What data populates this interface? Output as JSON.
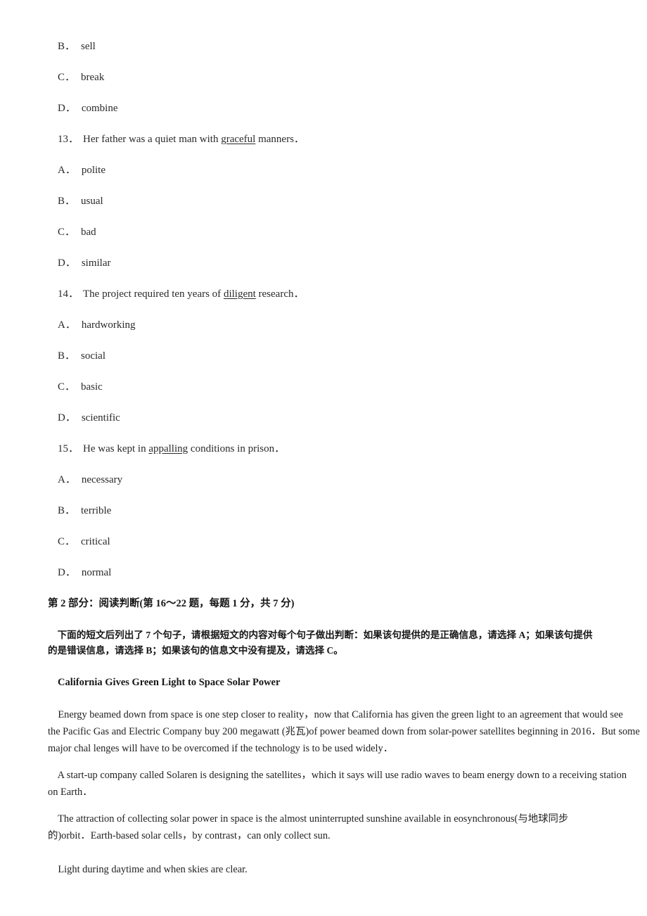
{
  "page": {
    "background": "#ffffff",
    "text_color": "#222222"
  },
  "vocabulary": {
    "carryover_options": [
      {
        "letter": "B．",
        "text": "sell"
      },
      {
        "letter": "C．",
        "text": "break"
      },
      {
        "letter": "D．",
        "text": "combine"
      }
    ],
    "questions": [
      {
        "number": "13．",
        "stem_before": "Her father was a quiet man with ",
        "stem_underlined": "graceful",
        "stem_after": " manners．",
        "options": [
          {
            "letter": "A．",
            "text": "polite"
          },
          {
            "letter": "B．",
            "text": "usual"
          },
          {
            "letter": "C．",
            "text": "bad"
          },
          {
            "letter": "D．",
            "text": "similar"
          }
        ]
      },
      {
        "number": "14．",
        "stem_before": "The project required ten years of ",
        "stem_underlined": "diligent",
        "stem_after": " research．",
        "options": [
          {
            "letter": "A．",
            "text": "hardworking"
          },
          {
            "letter": "B．",
            "text": "social"
          },
          {
            "letter": "C．",
            "text": "basic"
          },
          {
            "letter": "D．",
            "text": "scientific"
          }
        ]
      },
      {
        "number": "15．",
        "stem_before": "He was kept in ",
        "stem_underlined": "appalling",
        "stem_after": " conditions in prison．",
        "options": [
          {
            "letter": "A．",
            "text": "necessary"
          },
          {
            "letter": "B．",
            "text": "terrible"
          },
          {
            "letter": "C．",
            "text": "critical"
          },
          {
            "letter": "D．",
            "text": "normal"
          }
        ]
      }
    ]
  },
  "part2": {
    "heading": "第 2 部分：阅读判断(第 16～22 题，每题 1 分，共 7 分)",
    "instruction_line1": "    下面的短文后列出了 7 个句子，请根据短文的内容对每个句子做出判断：如果该句提供的是正确信息，请选择 A；如果该句提供",
    "instruction_line2": "的是错误信息，请选择 B；如果该句的信息文中没有提及，请选择 C。",
    "article_title": "California Gives Green Light to Space Solar Power",
    "paragraphs": [
      {
        "lines": [
          "    Energy beamed down from space is one step closer to reality，now that California has given the green light to an agreement that would see",
          "the Pacific Gas and Electric Company buy 200 megawatt (兆瓦)of power beamed down from solar-power satellites beginning in 2016．But some",
          "major chal lenges will have to be overcomed if the technology is to be used widely．"
        ]
      },
      {
        "lines": [
          "    A start-up company called Solaren is designing the satellites，which it says will use radio waves to beam energy down to a receiving station",
          "on Earth．"
        ]
      },
      {
        "lines": [
          "    The attraction of collecting solar power in space is the almost uninterrupted sunshine available in eosynchronous(与地球同步",
          "的)orbit．Earth-based solar cells，by contrast，can only collect sun."
        ]
      },
      {
        "lines": [
          "    Light during daytime and when skies are clear."
        ]
      }
    ]
  }
}
